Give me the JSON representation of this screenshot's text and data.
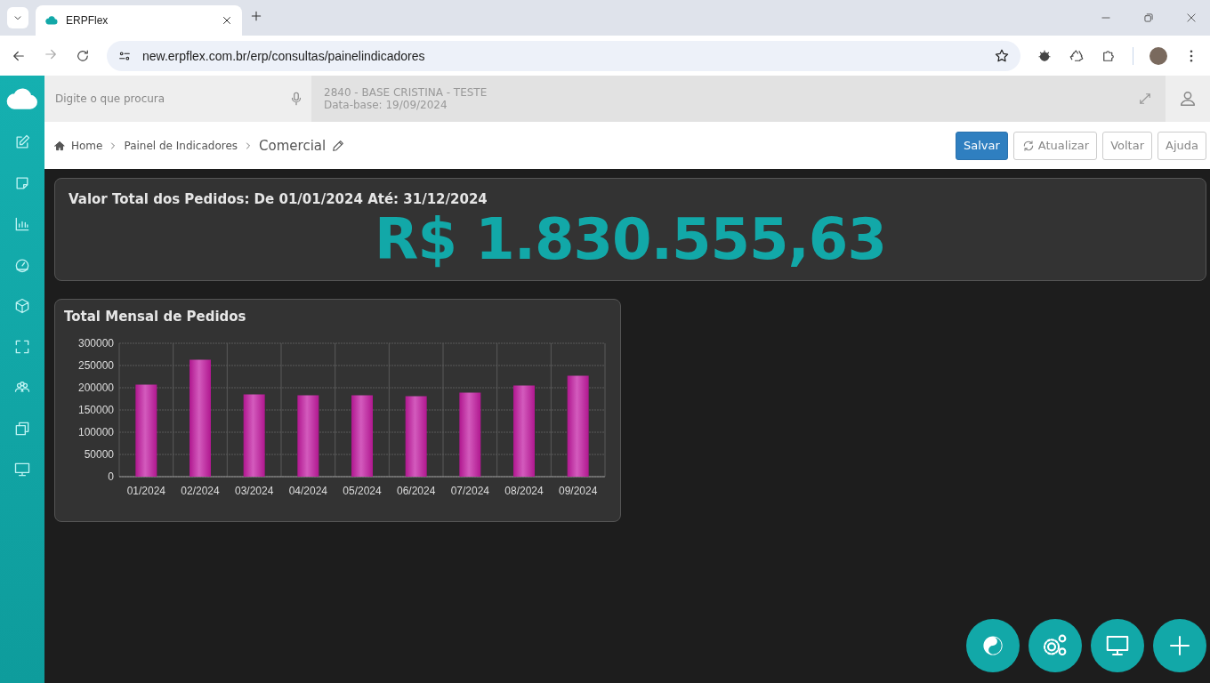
{
  "browser": {
    "tab_title": "ERPFlex",
    "url": "new.erpflex.com.br/erp/consultas/painelindicadores"
  },
  "topbar": {
    "search": {
      "placeholder": "Digite o que procura"
    },
    "company": "2840 - BASE CRISTINA - TESTE",
    "database_date": "Data-base: 19/09/2024"
  },
  "breadcrumb": {
    "items": [
      "Home",
      "Painel de Indicadores"
    ],
    "current": "Comercial"
  },
  "actions": [
    {
      "label": "Salvar",
      "kind": "primary"
    },
    {
      "label": "Atualizar",
      "kind": "refresh"
    },
    {
      "label": "Voltar",
      "kind": "plain"
    },
    {
      "label": "Ajuda",
      "kind": "plain"
    }
  ],
  "kpi": {
    "title": "Valor Total dos Pedidos: De 01/01/2024 Até: 31/12/2024",
    "value": "R$ 1.830.555,63"
  },
  "chart_panel": {
    "title": "Total Mensal de Pedidos",
    "chart_data": {
      "type": "bar",
      "categories": [
        "01/2024",
        "02/2024",
        "03/2024",
        "04/2024",
        "05/2024",
        "06/2024",
        "07/2024",
        "08/2024",
        "09/2024"
      ],
      "values": [
        207000,
        263000,
        185000,
        183000,
        183000,
        181000,
        189000,
        205000,
        227000
      ],
      "ylim": [
        0,
        300000
      ],
      "yticks": [
        0,
        50000,
        100000,
        150000,
        200000,
        250000,
        300000
      ],
      "grid": true
    }
  }
}
